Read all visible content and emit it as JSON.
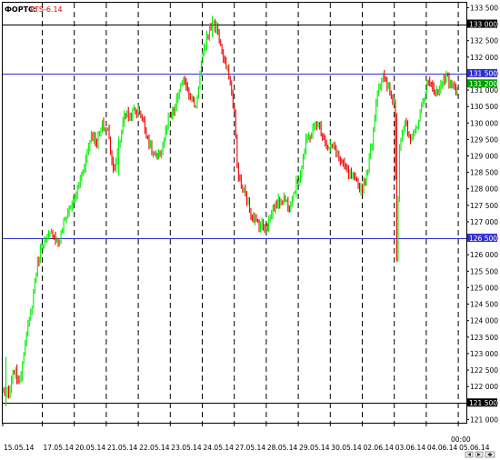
{
  "chart_data": {
    "type": "candlestick-bars",
    "title_prefix": "ФОРТС:",
    "title_symbol": "RTS-6.14",
    "y_ticks": [
      "133 500",
      "133 000",
      "132 500",
      "132 000",
      "131 500",
      "131 000",
      "130 500",
      "130 000",
      "129 500",
      "129 000",
      "128 500",
      "128 000",
      "127 500",
      "127 000",
      "126 500",
      "126 000",
      "125 500",
      "125 000",
      "124 500",
      "124 000",
      "123 500",
      "123 000",
      "122 500",
      "122 000",
      "121 500",
      "121 000"
    ],
    "ylim": [
      120900,
      133650
    ],
    "x_ticks": [
      "15.05.14",
      "17.05.14",
      "20.05.14",
      "21.05.14",
      "22.05.14",
      "23.05.14",
      "24.05.14",
      "27.05.14",
      "28.05.14",
      "29.05.14",
      "30.05.14",
      "02.06.14",
      "03.06.14",
      "04.06.14",
      "05.06.14"
    ],
    "x_time_label": "00:00",
    "day_separators_count": 14,
    "horizontal_levels": [
      {
        "value": 133000,
        "label": "133 000",
        "color": "#000000"
      },
      {
        "value": 131500,
        "label": "131 500",
        "color": "#3030d0"
      },
      {
        "value": 126500,
        "label": "126 500",
        "color": "#3030d0"
      },
      {
        "value": 121500,
        "label": "121 500",
        "color": "#000000"
      }
    ],
    "current_price": {
      "value": 131200,
      "label": "131 200",
      "color": "#00a000"
    },
    "colors": {
      "up": "#00ee00",
      "down": "#ee0000",
      "grid": "#000000",
      "background": "#ffffff"
    },
    "anchors": [
      [
        0,
        121900
      ],
      [
        4,
        121700
      ],
      [
        8,
        122500
      ],
      [
        12,
        122100
      ],
      [
        16,
        123400
      ],
      [
        20,
        124200
      ],
      [
        24,
        125500
      ],
      [
        28,
        126300
      ],
      [
        32,
        126500
      ],
      [
        36,
        126700
      ],
      [
        40,
        126300
      ],
      [
        44,
        127000
      ],
      [
        48,
        127400
      ],
      [
        52,
        127700
      ],
      [
        56,
        128300
      ],
      [
        60,
        128900
      ],
      [
        64,
        129700
      ],
      [
        68,
        129400
      ],
      [
        72,
        129900
      ],
      [
        76,
        129800
      ],
      [
        80,
        128600
      ],
      [
        84,
        129200
      ],
      [
        88,
        130300
      ],
      [
        92,
        130200
      ],
      [
        96,
        130400
      ],
      [
        100,
        130300
      ],
      [
        104,
        129700
      ],
      [
        108,
        129100
      ],
      [
        112,
        128900
      ],
      [
        116,
        129300
      ],
      [
        120,
        130100
      ],
      [
        124,
        130300
      ],
      [
        128,
        131000
      ],
      [
        132,
        131300
      ],
      [
        136,
        130800
      ],
      [
        140,
        130500
      ],
      [
        144,
        131800
      ],
      [
        148,
        132600
      ],
      [
        152,
        133100
      ],
      [
        156,
        132800
      ],
      [
        160,
        131900
      ],
      [
        164,
        131500
      ],
      [
        168,
        130300
      ],
      [
        170,
        128700
      ],
      [
        172,
        128200
      ],
      [
        176,
        127800
      ],
      [
        180,
        127300
      ],
      [
        184,
        127000
      ],
      [
        188,
        126900
      ],
      [
        192,
        126900
      ],
      [
        196,
        127400
      ],
      [
        200,
        127600
      ],
      [
        204,
        127700
      ],
      [
        208,
        127500
      ],
      [
        212,
        128000
      ],
      [
        216,
        128500
      ],
      [
        220,
        129400
      ],
      [
        224,
        129700
      ],
      [
        228,
        130000
      ],
      [
        232,
        129700
      ],
      [
        236,
        129200
      ],
      [
        240,
        129300
      ],
      [
        244,
        128900
      ],
      [
        248,
        128600
      ],
      [
        252,
        128400
      ],
      [
        256,
        128200
      ],
      [
        260,
        128000
      ],
      [
        264,
        128400
      ],
      [
        268,
        129400
      ],
      [
        272,
        131000
      ],
      [
        276,
        131400
      ],
      [
        280,
        131000
      ],
      [
        284,
        130600
      ],
      [
        286,
        126000
      ],
      [
        288,
        129400
      ],
      [
        292,
        130000
      ],
      [
        296,
        129400
      ],
      [
        300,
        129800
      ],
      [
        304,
        130500
      ],
      [
        308,
        131200
      ],
      [
        312,
        131100
      ],
      [
        316,
        130900
      ],
      [
        320,
        131400
      ],
      [
        324,
        131300
      ],
      [
        328,
        131000
      ],
      [
        330,
        131100
      ]
    ],
    "spikes": [
      {
        "index": 286,
        "high": 130300,
        "low": 125800
      },
      {
        "index": 84,
        "high": 129600,
        "low": 128400
      },
      {
        "index": 152,
        "high": 133250,
        "low": 132600
      },
      {
        "index": 2,
        "high": 122900,
        "low": 121400
      }
    ]
  }
}
